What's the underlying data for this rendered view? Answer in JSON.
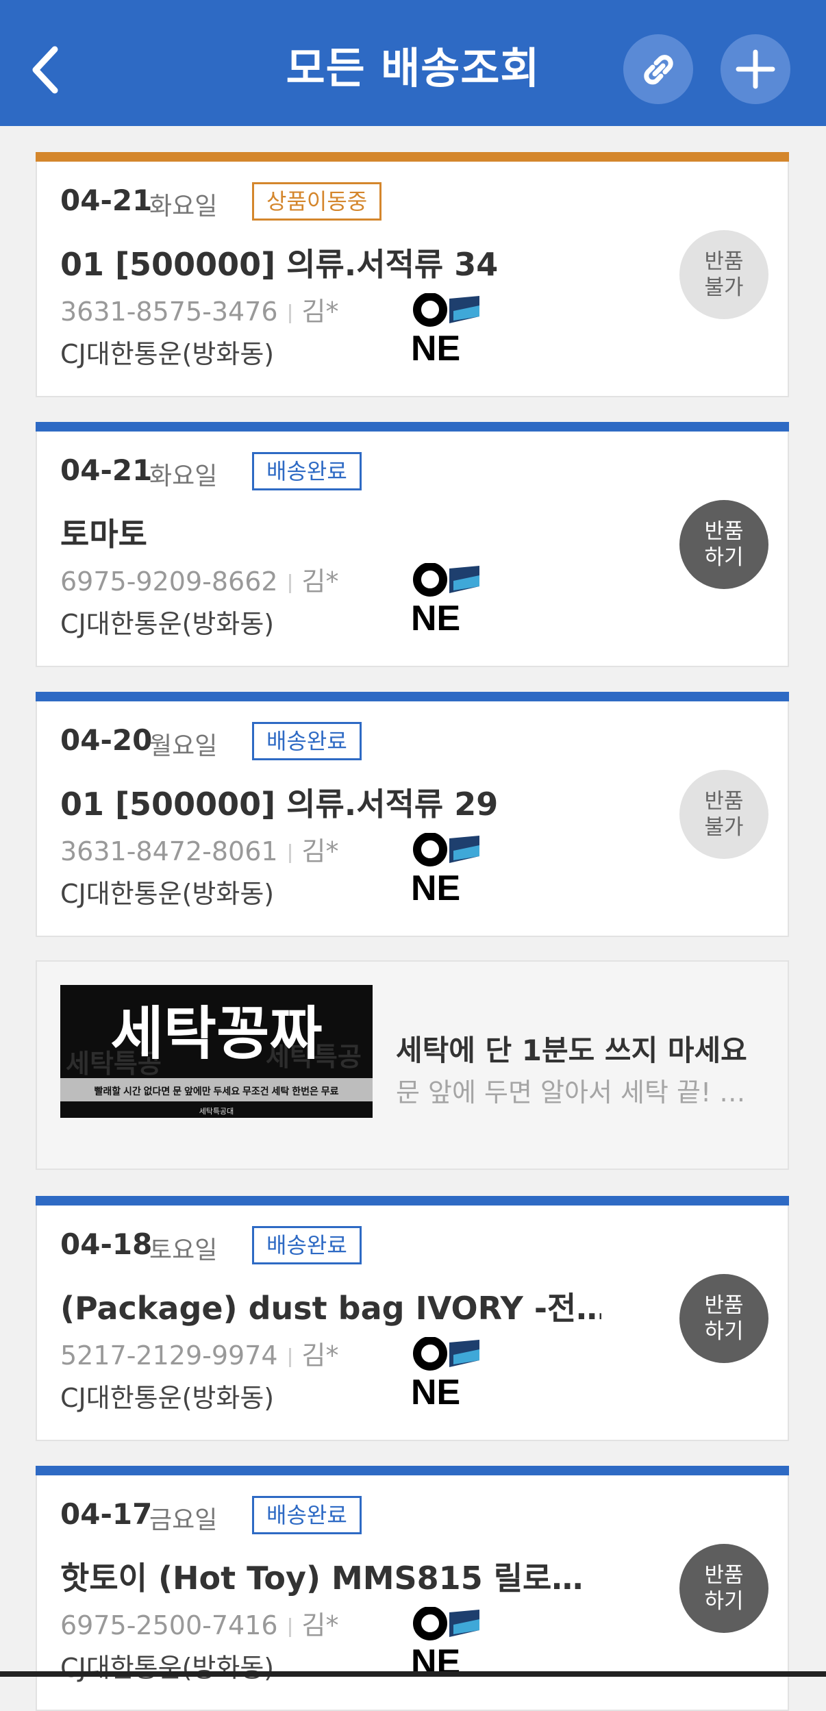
{
  "header": {
    "title": "모든 배송조회",
    "back_icon": "chevron-left-icon",
    "link_icon": "link-icon",
    "add_icon": "plus-icon",
    "color": "#2e6ac4"
  },
  "deliveries": [
    {
      "date": "04-21",
      "day": "화요일",
      "status": "상품이동중",
      "status_color": "#d4862c",
      "title": "01 [500000] 의류.서적류 34",
      "tracking": "3631-8575-3476",
      "recipient": "김*",
      "courier": "CJ대한통운(방화동)",
      "return_label_1": "반품",
      "return_label_2": "불가"
    },
    {
      "date": "04-21",
      "day": "화요일",
      "status": "배송완료",
      "status_color": "#2e6ac4",
      "title": "토마토",
      "tracking": "6975-9209-8662",
      "recipient": "김*",
      "courier": "CJ대한통운(방화동)",
      "return_label_1": "반품",
      "return_label_2": "하기"
    },
    {
      "date": "04-20",
      "day": "월요일",
      "status": "배송완료",
      "status_color": "#2e6ac4",
      "title": "01 [500000] 의류.서적류 29",
      "tracking": "3631-8472-8061",
      "recipient": "김*",
      "courier": "CJ대한통운(방화동)",
      "return_label_1": "반품",
      "return_label_2": "불가"
    },
    {
      "date": "04-18",
      "day": "토요일",
      "status": "배송완료",
      "status_color": "#2e6ac4",
      "title": "(Package) dust bag IVORY -전…",
      "tracking": "5217-2129-9974",
      "recipient": "김*",
      "courier": "CJ대한통운(방화동)",
      "return_label_1": "반품",
      "return_label_2": "하기"
    },
    {
      "date": "04-17",
      "day": "금요일",
      "status": "배송완료",
      "status_color": "#2e6ac4",
      "title": "핫토이 (Hot Toy) MMS815 릴로…",
      "tracking": "6975-2500-7416",
      "recipient": "김*",
      "courier": "CJ대한통운(방화동)",
      "return_label_1": "반품",
      "return_label_2": "하기"
    }
  ],
  "ad": {
    "image_title": "세탁꽁짜",
    "image_watermark_left": "세탁특공",
    "image_watermark_right": "세탁특공",
    "image_caption": "빨래할 시간 없다면 문 앞에만 두세요  무조건 세탁 한번은 무료",
    "image_brand": "세탁특공대",
    "title": "세탁에 단 1분도 쓰지 마세요",
    "subtitle": "문 앞에 두면 알아서 세탁 끝! …"
  },
  "logo": {
    "text_top": "O",
    "text_bottom": "NE"
  }
}
